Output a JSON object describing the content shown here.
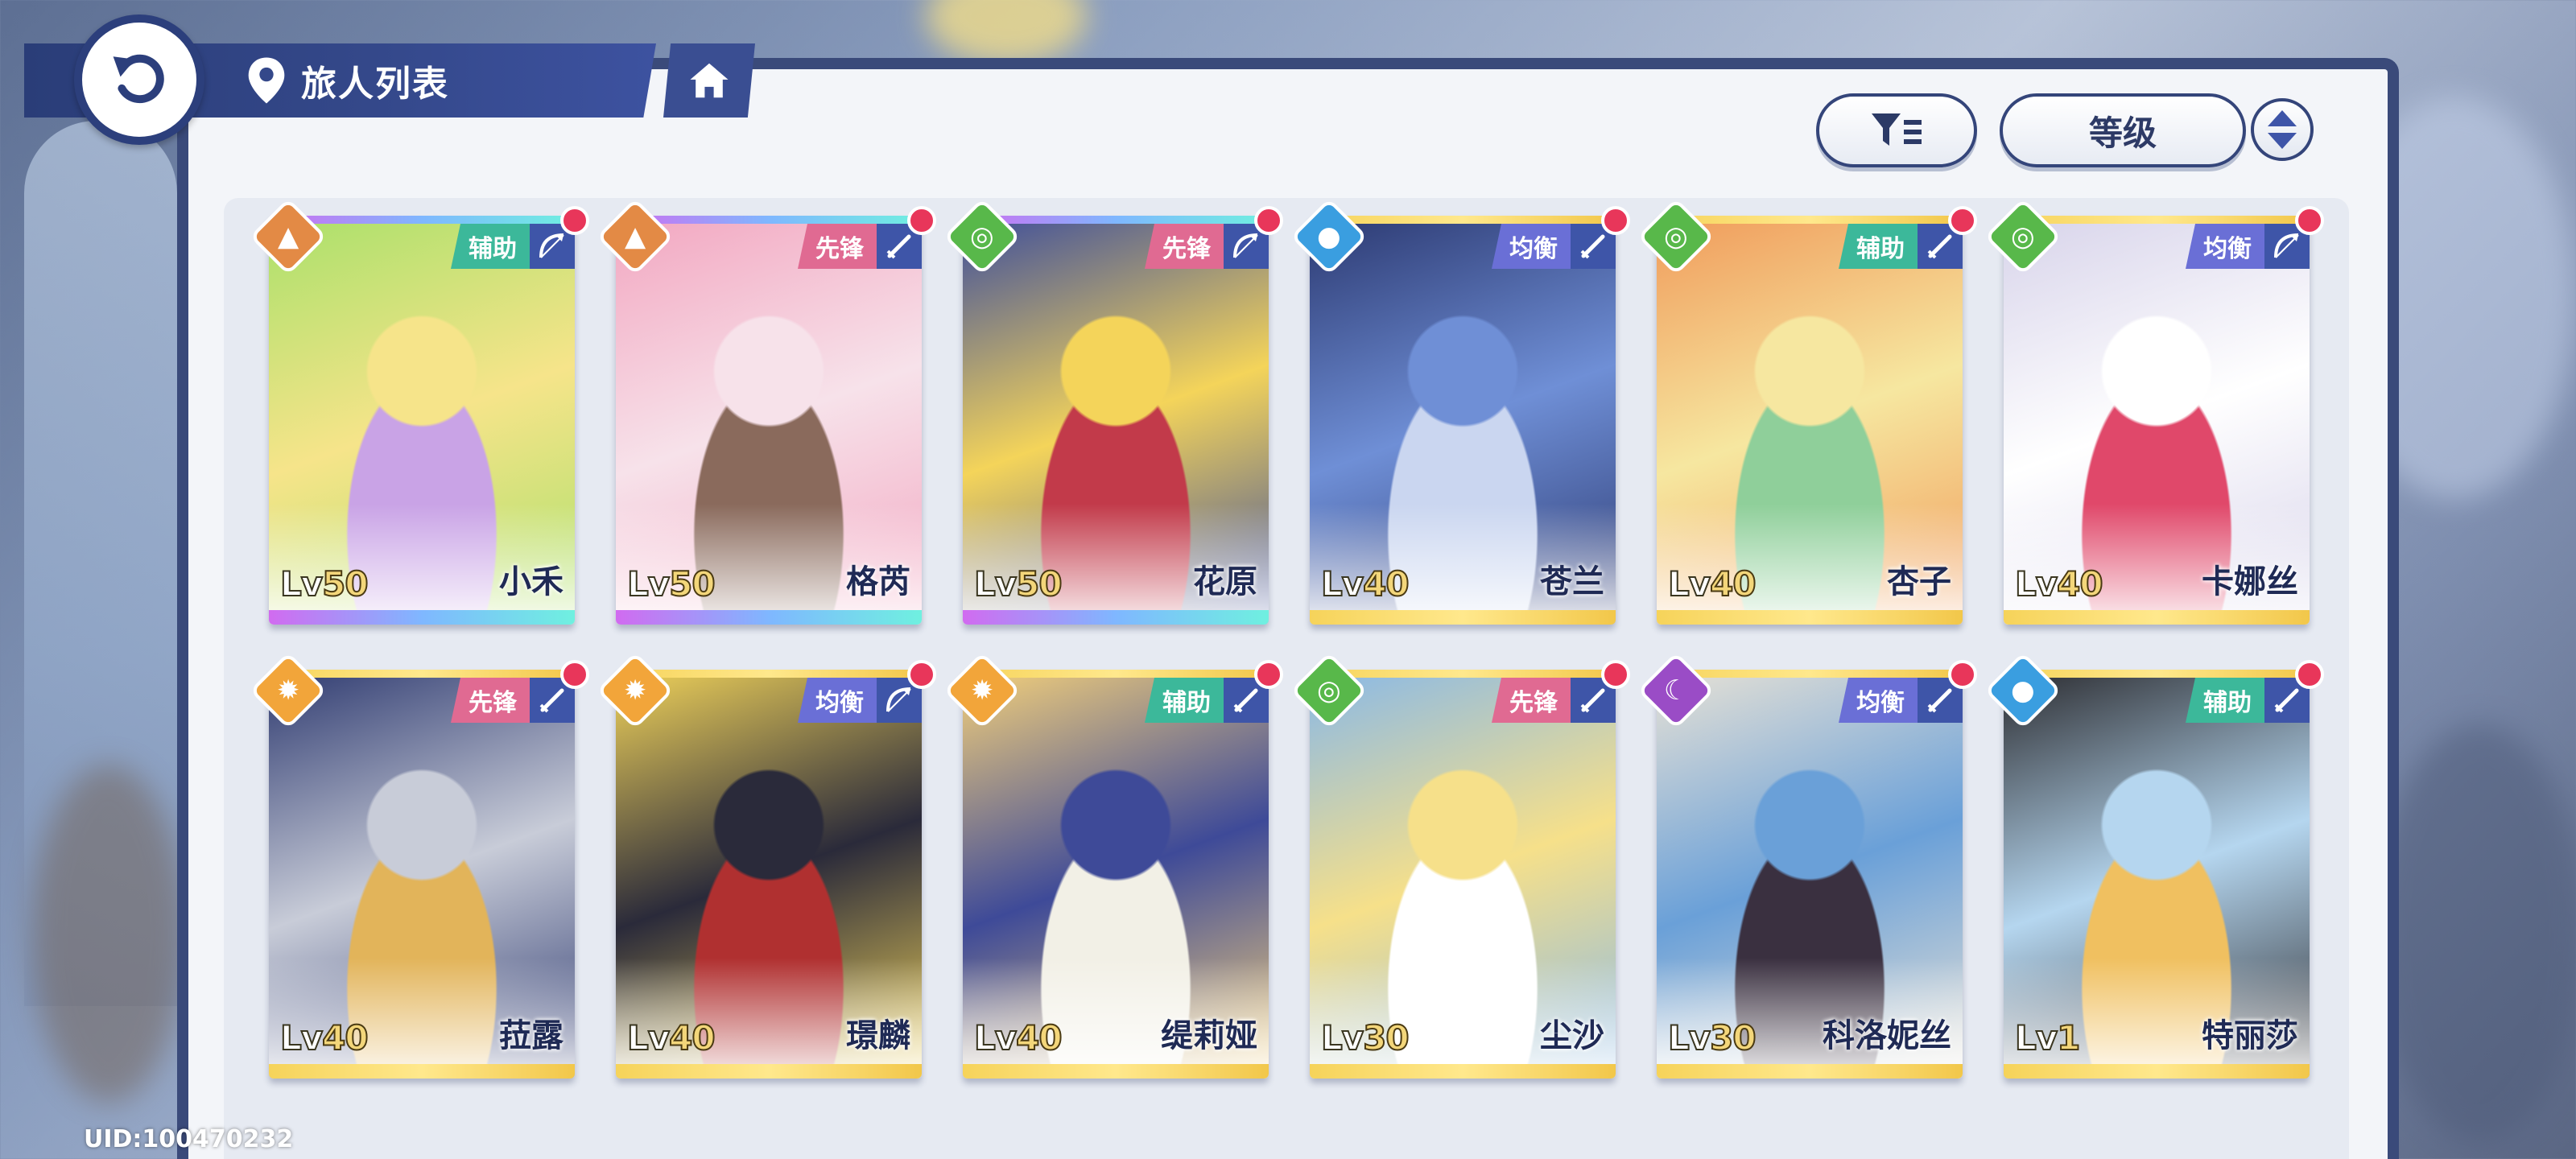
{
  "header": {
    "title": "旅人列表",
    "back_icon": "back-arrow-icon",
    "location_icon": "location-pin-icon",
    "home_icon": "home-icon"
  },
  "controls": {
    "filter_icon": "filter-icon",
    "sort_label": "等级",
    "order_icon": "sort-order-icon"
  },
  "cards": [
    {
      "name": "小禾",
      "level": "50",
      "role": "辅助",
      "element": "earth",
      "weapon": "bow",
      "rarity": "rainbow",
      "has_alert": true
    },
    {
      "name": "格芮",
      "level": "50",
      "role": "先锋",
      "element": "earth",
      "weapon": "sword",
      "rarity": "rainbow",
      "has_alert": true
    },
    {
      "name": "花原",
      "level": "50",
      "role": "先锋",
      "element": "wind",
      "weapon": "bow",
      "rarity": "rainbow",
      "has_alert": true
    },
    {
      "name": "苍兰",
      "level": "40",
      "role": "均衡",
      "element": "water",
      "weapon": "sword",
      "rarity": "gold",
      "has_alert": true
    },
    {
      "name": "杏子",
      "level": "40",
      "role": "辅助",
      "element": "wind",
      "weapon": "sword",
      "rarity": "gold",
      "has_alert": true
    },
    {
      "name": "卡娜丝",
      "level": "40",
      "role": "均衡",
      "element": "wind",
      "weapon": "bow",
      "rarity": "gold",
      "has_alert": true
    },
    {
      "name": "菈露",
      "level": "40",
      "role": "先锋",
      "element": "sun",
      "weapon": "sword",
      "rarity": "gold",
      "has_alert": true
    },
    {
      "name": "璟麟",
      "level": "40",
      "role": "均衡",
      "element": "sun",
      "weapon": "bow",
      "rarity": "gold",
      "has_alert": true
    },
    {
      "name": "缇莉娅",
      "level": "40",
      "role": "辅助",
      "element": "sun",
      "weapon": "sword",
      "rarity": "gold",
      "has_alert": true
    },
    {
      "name": "尘沙",
      "level": "30",
      "role": "先锋",
      "element": "wind",
      "weapon": "sword",
      "rarity": "gold",
      "has_alert": true
    },
    {
      "name": "科洛妮丝",
      "level": "30",
      "role": "均衡",
      "element": "moon",
      "weapon": "sword",
      "rarity": "gold",
      "has_alert": true
    },
    {
      "name": "特丽莎",
      "level": "1",
      "role": "辅助",
      "element": "water",
      "weapon": "sword",
      "rarity": "gold",
      "has_alert": true
    }
  ],
  "lv_prefix": "Lv",
  "footer": {
    "uid": "UID:100470232"
  },
  "colors": {
    "panel_border": "#3a4a7a",
    "role_辅助": "#3cb89a",
    "role_先锋": "#e06a92",
    "role_均衡": "#6a6fd6",
    "elem_earth": "#e38a45",
    "elem_wind": "#58b84a",
    "elem_water": "#3a9ee0",
    "elem_sun": "#f2a53a",
    "elem_moon": "#9a4cc6"
  }
}
